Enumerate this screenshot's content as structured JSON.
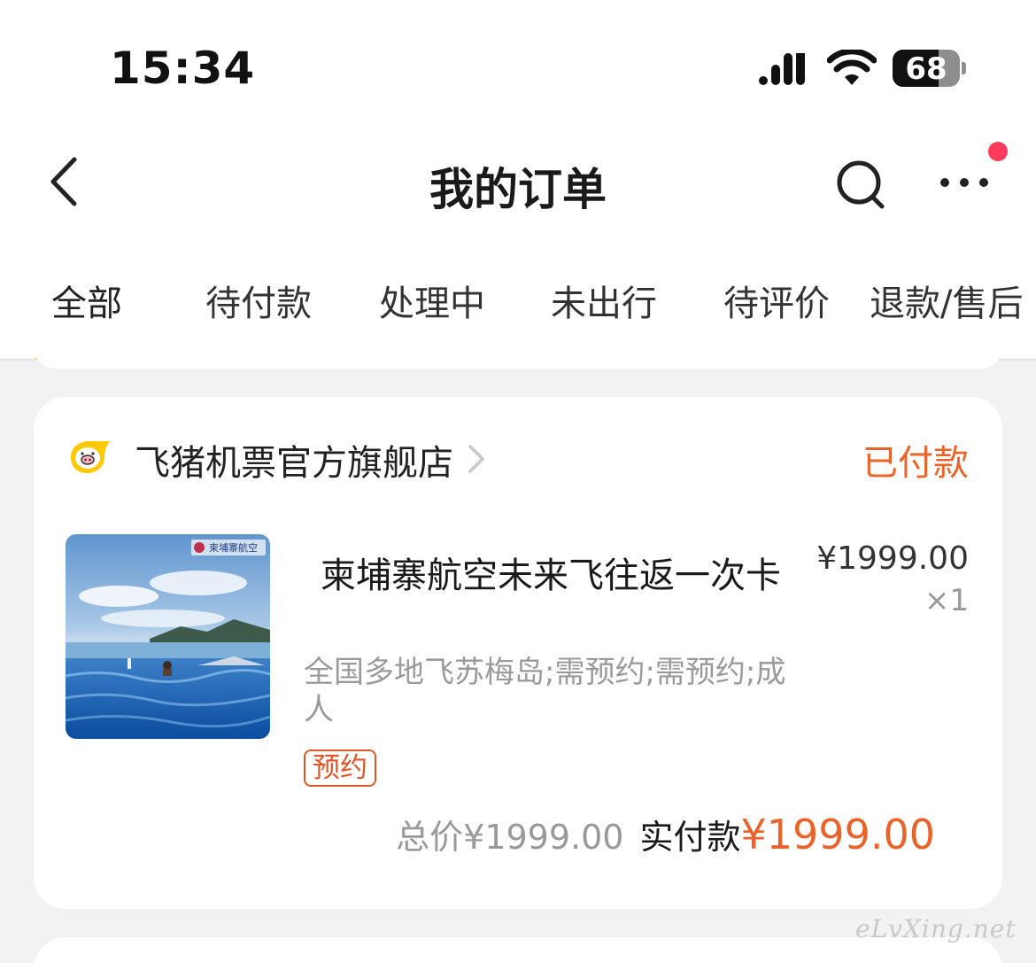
{
  "status_bar": {
    "time": "15:34",
    "battery_level": "68",
    "battery_fraction": 0.68
  },
  "header": {
    "title": "我的订单"
  },
  "tabs": [
    {
      "label": "全部",
      "active": true
    },
    {
      "label": "待付款",
      "active": false
    },
    {
      "label": "处理中",
      "active": false
    },
    {
      "label": "未出行",
      "active": false
    },
    {
      "label": "待评价",
      "active": false
    },
    {
      "label": "退款/售后",
      "active": false
    }
  ],
  "order": {
    "store_name": "飞猪机票官方旗舰店",
    "status": "已付款",
    "product": {
      "title": "柬埔寨航空未来飞往返一次卡",
      "specs": "全国多地飞苏梅岛;需预约;需预约;成人",
      "tag": "预约",
      "unit_price": "¥1999.00",
      "quantity": "×1",
      "image_logo_text": "柬埔寨航空"
    },
    "total_label": "总价¥1999.00",
    "paid_label": "实付款",
    "paid_amount": "¥1999.00"
  },
  "watermark": "eLvXing.net",
  "colors": {
    "accent": "#ffcc00",
    "status_orange": "#e8642a",
    "notification_red": "#ff3b5c"
  }
}
